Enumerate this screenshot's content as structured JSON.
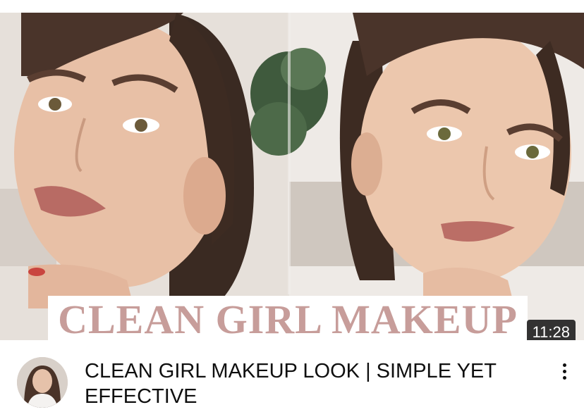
{
  "video": {
    "thumbnail_text": "CLEAN GIRL MAKEUP",
    "duration": "11:28",
    "title": "CLEAN GIRL MAKEUP LOOK | SIMPLE YET EFFECTIVE"
  },
  "icons": {
    "more": "more-vert-icon",
    "avatar": "channel-avatar"
  },
  "colors": {
    "thumbnail_title": "#c79d9a",
    "duration_bg": "#141414",
    "text": "#0f0f0f"
  }
}
